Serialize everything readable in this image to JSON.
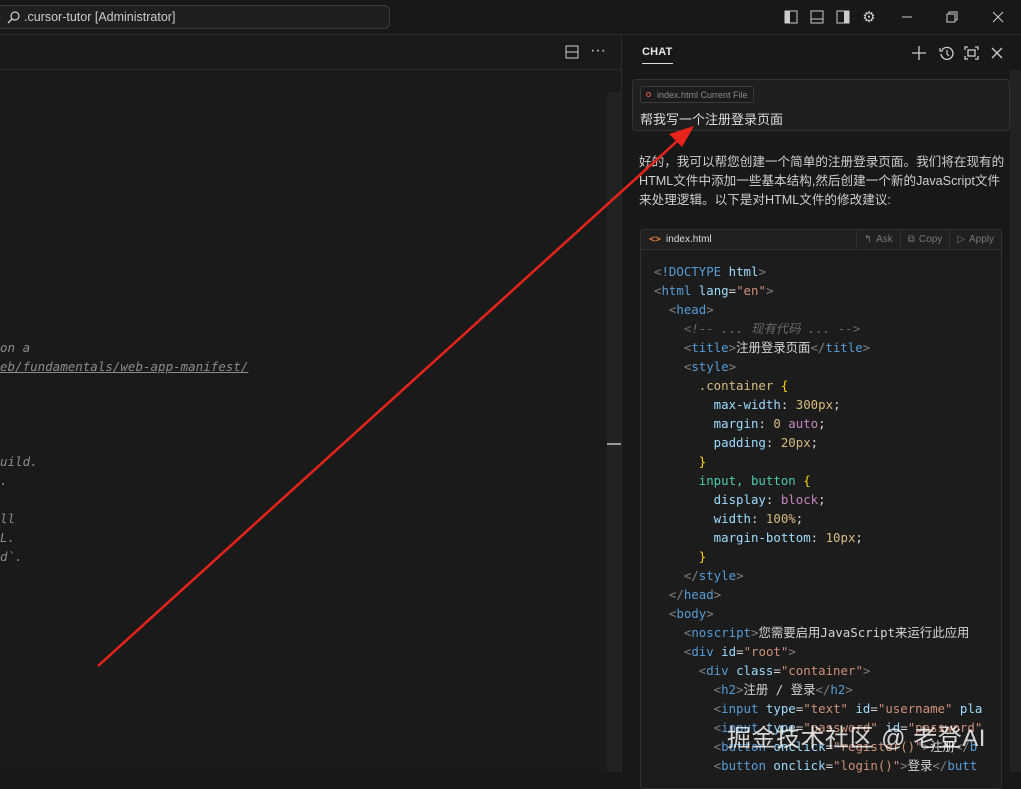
{
  "titlebar": {
    "search_text": ".cursor-tutor [Administrator]"
  },
  "editor": {
    "lines": [
      "on a",
      "eb/fundamentals/web-app-manifest/",
      "uild.",
      ".",
      "ll",
      "L.",
      "d`."
    ]
  },
  "chat": {
    "tab_label": "CHAT",
    "chip_file": "index.html",
    "chip_label": "Current File",
    "prompt": "帮我写一个注册登录页面",
    "response": "好的，我可以帮您创建一个简单的注册登录页面。我们将在现有的HTML文件中添加一些基本结构,然后创建一个新的JavaScript文件来处理逻辑。以下是对HTML文件的修改建议:",
    "code_file": "index.html",
    "ask_label": "Ask",
    "copy_label": "Copy",
    "apply_label": "Apply",
    "code_lines": [
      [
        [
          "<",
          "p"
        ],
        [
          "!DOCTYPE",
          "t"
        ],
        [
          " html",
          "a"
        ],
        [
          ">",
          "p"
        ]
      ],
      [
        [
          "<",
          "p"
        ],
        [
          "html",
          "t"
        ],
        [
          " lang",
          "a"
        ],
        [
          "=",
          "x"
        ],
        [
          "\"en\"",
          "s"
        ],
        [
          ">",
          "p"
        ]
      ],
      [
        [
          "  <",
          "p"
        ],
        [
          "head",
          "t"
        ],
        [
          ">",
          "p"
        ]
      ],
      [
        [
          "    <!-- ... 现有代码 ... -->",
          "c"
        ]
      ],
      [
        [
          "    <",
          "p"
        ],
        [
          "title",
          "t"
        ],
        [
          ">",
          "p"
        ],
        [
          "注册登录页面",
          "x"
        ],
        [
          "</",
          "p"
        ],
        [
          "title",
          "t"
        ],
        [
          ">",
          "p"
        ]
      ],
      [
        [
          "    <",
          "p"
        ],
        [
          "style",
          "t"
        ],
        [
          ">",
          "p"
        ]
      ],
      [
        [
          "      .container",
          "sel"
        ],
        [
          " {",
          "b"
        ]
      ],
      [
        [
          "        max-width",
          "pr"
        ],
        [
          ": ",
          "x"
        ],
        [
          "300px",
          "n"
        ],
        [
          ";",
          "x"
        ]
      ],
      [
        [
          "        margin",
          "pr"
        ],
        [
          ": ",
          "x"
        ],
        [
          "0",
          "n"
        ],
        [
          " auto",
          "k"
        ],
        [
          ";",
          "x"
        ]
      ],
      [
        [
          "        padding",
          "pr"
        ],
        [
          ": ",
          "x"
        ],
        [
          "20px",
          "n"
        ],
        [
          ";",
          "x"
        ]
      ],
      [
        [
          "      }",
          "b"
        ]
      ],
      [
        [
          "      input, button",
          "g"
        ],
        [
          " {",
          "b"
        ]
      ],
      [
        [
          "        display",
          "pr"
        ],
        [
          ": ",
          "x"
        ],
        [
          "block",
          "k"
        ],
        [
          ";",
          "x"
        ]
      ],
      [
        [
          "        width",
          "pr"
        ],
        [
          ": ",
          "x"
        ],
        [
          "100%",
          "n"
        ],
        [
          ";",
          "x"
        ]
      ],
      [
        [
          "        margin-bottom",
          "pr"
        ],
        [
          ": ",
          "x"
        ],
        [
          "10px",
          "n"
        ],
        [
          ";",
          "x"
        ]
      ],
      [
        [
          "      }",
          "b"
        ]
      ],
      [
        [
          "    </",
          "p"
        ],
        [
          "style",
          "t"
        ],
        [
          ">",
          "p"
        ]
      ],
      [
        [
          "  </",
          "p"
        ],
        [
          "head",
          "t"
        ],
        [
          ">",
          "p"
        ]
      ],
      [
        [
          "  <",
          "p"
        ],
        [
          "body",
          "t"
        ],
        [
          ">",
          "p"
        ]
      ],
      [
        [
          "    <",
          "p"
        ],
        [
          "noscript",
          "t"
        ],
        [
          ">",
          "p"
        ],
        [
          "您需要启用JavaScript来运行此应用",
          "x"
        ]
      ],
      [
        [
          "    <",
          "p"
        ],
        [
          "div",
          "t"
        ],
        [
          " id",
          "a"
        ],
        [
          "=",
          "x"
        ],
        [
          "\"root\"",
          "s"
        ],
        [
          ">",
          "p"
        ]
      ],
      [
        [
          "      <",
          "p"
        ],
        [
          "div",
          "t"
        ],
        [
          " class",
          "a"
        ],
        [
          "=",
          "x"
        ],
        [
          "\"container\"",
          "s"
        ],
        [
          ">",
          "p"
        ]
      ],
      [
        [
          "        <",
          "p"
        ],
        [
          "h2",
          "t"
        ],
        [
          ">",
          "p"
        ],
        [
          "注册 / 登录",
          "x"
        ],
        [
          "</",
          "p"
        ],
        [
          "h2",
          "t"
        ],
        [
          ">",
          "p"
        ]
      ],
      [
        [
          "        <",
          "p"
        ],
        [
          "input",
          "t"
        ],
        [
          " type",
          "a"
        ],
        [
          "=",
          "x"
        ],
        [
          "\"text\"",
          "s"
        ],
        [
          " id",
          "a"
        ],
        [
          "=",
          "x"
        ],
        [
          "\"username\"",
          "s"
        ],
        [
          " pla",
          "a"
        ]
      ],
      [
        [
          "        <",
          "p"
        ],
        [
          "input",
          "t"
        ],
        [
          " type",
          "a"
        ],
        [
          "=",
          "x"
        ],
        [
          "\"password\"",
          "s"
        ],
        [
          " id",
          "a"
        ],
        [
          "=",
          "x"
        ],
        [
          "\"password\"",
          "s"
        ]
      ],
      [
        [
          "        <",
          "p"
        ],
        [
          "button",
          "t"
        ],
        [
          " onclick",
          "a"
        ],
        [
          "=",
          "x"
        ],
        [
          "\"register()\"",
          "s"
        ],
        [
          ">",
          "p"
        ],
        [
          "注册",
          "x"
        ],
        [
          "</",
          "p"
        ],
        [
          "b",
          "t"
        ]
      ],
      [
        [
          "        <",
          "p"
        ],
        [
          "button",
          "t"
        ],
        [
          " onclick",
          "a"
        ],
        [
          "=",
          "x"
        ],
        [
          "\"login()\"",
          "s"
        ],
        [
          ">",
          "p"
        ],
        [
          "登录",
          "x"
        ],
        [
          "</",
          "p"
        ],
        [
          "butt",
          "t"
        ]
      ]
    ]
  },
  "watermark": "掘金技术社区 @ 老登AI",
  "colors": {
    "arrow": "#e8231b",
    "accent": "#e07b39"
  }
}
